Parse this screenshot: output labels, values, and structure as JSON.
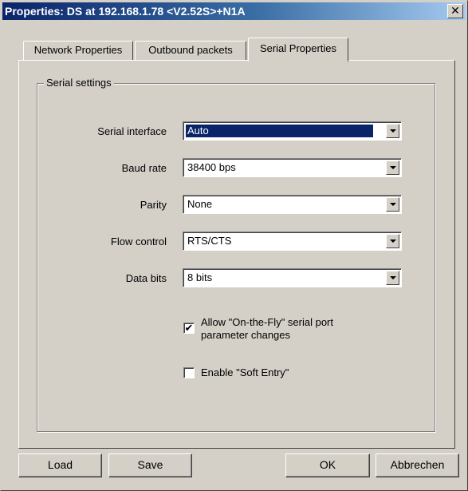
{
  "window": {
    "title": "Properties: DS at 192.168.1.78 <V2.52S>+N1A",
    "close_glyph": "✕"
  },
  "tabs": [
    {
      "label": "Network Properties",
      "active": false
    },
    {
      "label": "Outbound packets",
      "active": false
    },
    {
      "label": "Serial Properties",
      "active": true
    }
  ],
  "serial": {
    "group_label": "Serial settings",
    "fields": [
      {
        "label": "Serial interface",
        "value": "Auto"
      },
      {
        "label": "Baud rate",
        "value": "38400 bps"
      },
      {
        "label": "Parity",
        "value": "None"
      },
      {
        "label": "Flow control",
        "value": "RTS/CTS"
      },
      {
        "label": "Data bits",
        "value": "8 bits"
      }
    ],
    "checkboxes": [
      {
        "label_line1": "Allow \"On-the-Fly\" serial port",
        "label_line2": "parameter changes",
        "checked": true,
        "mark": "✔"
      },
      {
        "label_line1": "Enable \"Soft Entry\"",
        "label_line2": "",
        "checked": false,
        "mark": ""
      }
    ]
  },
  "buttons": {
    "load": "Load",
    "save": "Save",
    "ok": "OK",
    "cancel": "Abbrechen"
  }
}
